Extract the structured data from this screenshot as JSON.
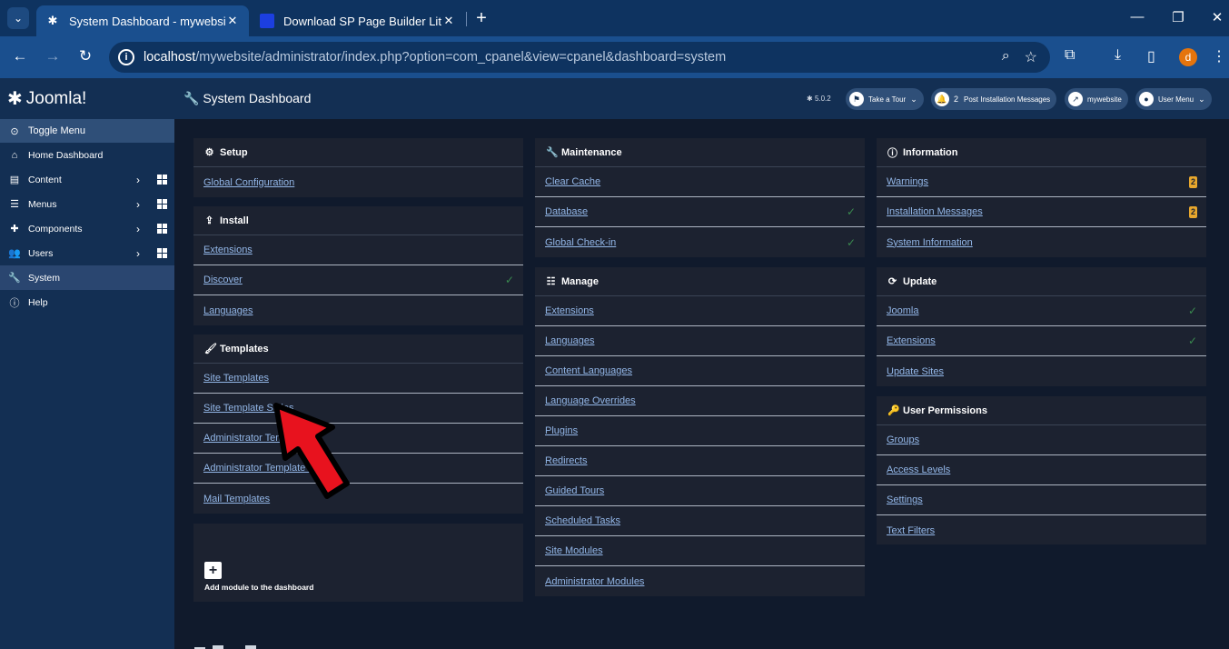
{
  "browser": {
    "tabs": [
      {
        "title": "System Dashboard - mywebsite",
        "favicon": "joomla-icon",
        "active": true
      },
      {
        "title": "Download SP Page Builder Lite",
        "favicon": "sp-page-builder-icon",
        "active": false
      }
    ],
    "url_host": "localhost",
    "url_path": "/mywebsite/administrator/index.php?option=com_cpanel&view=cpanel&dashboard=system",
    "profile_initial": "d"
  },
  "sidebar": {
    "logo_text": "Joomla!",
    "toggle_label": "Toggle Menu",
    "items": [
      {
        "label": "Home Dashboard",
        "icon": "home-icon"
      },
      {
        "label": "Content",
        "icon": "file-icon"
      },
      {
        "label": "Menus",
        "icon": "list-icon"
      },
      {
        "label": "Components",
        "icon": "puzzle-icon"
      },
      {
        "label": "Users",
        "icon": "users-icon"
      },
      {
        "label": "System",
        "icon": "wrench-icon"
      },
      {
        "label": "Help",
        "icon": "info-icon"
      }
    ]
  },
  "header": {
    "title": "System Dashboard",
    "version": "5.0.2",
    "take_tour": "Take a Tour",
    "notifications_count": "2",
    "post_install": "Post Installation Messages",
    "site_link": "mywebsite",
    "user_menu": "User Menu"
  },
  "modules": {
    "setup": {
      "title": "Setup",
      "items": [
        "Global Configuration"
      ]
    },
    "install": {
      "title": "Install",
      "items": [
        "Extensions",
        "Discover",
        "Languages"
      ]
    },
    "templates": {
      "title": "Templates",
      "items": [
        "Site Templates",
        "Site Template Styles",
        "Administrator Templates",
        "Administrator Template Styles",
        "Mail Templates"
      ]
    },
    "add_module": "Add module to the dashboard",
    "maintenance": {
      "title": "Maintenance",
      "items": [
        "Clear Cache",
        "Database",
        "Global Check-in"
      ]
    },
    "manage": {
      "title": "Manage",
      "items": [
        "Extensions",
        "Languages",
        "Content Languages",
        "Language Overrides",
        "Plugins",
        "Redirects",
        "Guided Tours",
        "Scheduled Tasks",
        "Site Modules",
        "Administrator Modules"
      ]
    },
    "information": {
      "title": "Information",
      "items": [
        "Warnings",
        "Installation Messages",
        "System Information"
      ],
      "warnings_badge": "2",
      "install_msgs_badge": "2"
    },
    "update": {
      "title": "Update",
      "items": [
        "Joomla",
        "Extensions",
        "Update Sites"
      ]
    },
    "permissions": {
      "title": "User Permissions",
      "items": [
        "Groups",
        "Access Levels",
        "Settings",
        "Text Filters"
      ]
    }
  },
  "colors": {
    "sidebar": "#132f53",
    "card": "#1c2230",
    "link": "#93b7e8",
    "badge": "#e8a72d",
    "check": "#3a8a4f",
    "arrow": "#e8121e"
  }
}
